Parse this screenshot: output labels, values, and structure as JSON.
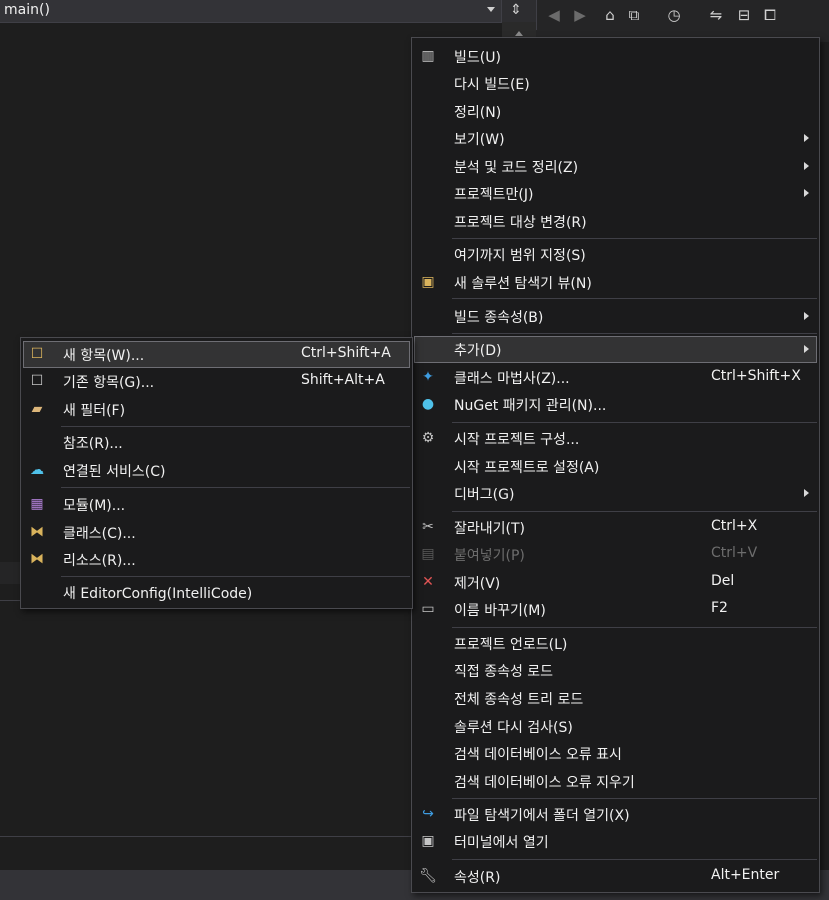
{
  "editor": {
    "function_dropdown": "main()"
  },
  "context_menu": {
    "items": [
      {
        "label": "빌드(U)",
        "icon": "build-icon"
      },
      {
        "label": "다시 빌드(E)"
      },
      {
        "label": "정리(N)"
      },
      {
        "label": "보기(W)",
        "submenu": true
      },
      {
        "label": "분석 및 코드 정리(Z)",
        "submenu": true
      },
      {
        "label": "프로젝트만(J)",
        "submenu": true
      },
      {
        "label": "프로젝트 대상 변경(R)"
      },
      {
        "label": "여기까지 범위 지정(S)"
      },
      {
        "label": "새 솔루션 탐색기 뷰(N)",
        "icon": "new-view-icon"
      },
      {
        "label": "빌드 종속성(B)",
        "submenu": true
      },
      {
        "label": "추가(D)",
        "submenu": true,
        "selected": true
      },
      {
        "label": "클래스 마법사(Z)...",
        "shortcut": "Ctrl+Shift+X",
        "icon": "class-wizard-icon"
      },
      {
        "label": "NuGet 패키지 관리(N)...",
        "icon": "nuget-icon"
      },
      {
        "label": "시작 프로젝트 구성...",
        "icon": "gear-icon"
      },
      {
        "label": "시작 프로젝트로 설정(A)"
      },
      {
        "label": "디버그(G)",
        "submenu": true
      },
      {
        "label": "잘라내기(T)",
        "shortcut": "Ctrl+X",
        "icon": "scissors-icon"
      },
      {
        "label": "붙여넣기(P)",
        "shortcut": "Ctrl+V",
        "icon": "paste-icon",
        "disabled": true
      },
      {
        "label": "제거(V)",
        "shortcut": "Del",
        "icon": "remove-icon"
      },
      {
        "label": "이름 바꾸기(M)",
        "shortcut": "F2",
        "icon": "rename-icon"
      },
      {
        "label": "프로젝트 언로드(L)"
      },
      {
        "label": "직접 종속성 로드"
      },
      {
        "label": "전체 종속성 트리 로드"
      },
      {
        "label": "솔루션 다시 검사(S)"
      },
      {
        "label": "검색 데이터베이스 오류 표시"
      },
      {
        "label": "검색 데이터베이스 오류 지우기"
      },
      {
        "label": "파일 탐색기에서 폴더 열기(X)",
        "icon": "open-folder-icon"
      },
      {
        "label": "터미널에서 열기",
        "icon": "terminal-icon"
      },
      {
        "label": "속성(R)",
        "shortcut": "Alt+Enter",
        "icon": "wrench-icon"
      }
    ]
  },
  "add_submenu": {
    "items": [
      {
        "label": "새 항목(W)...",
        "shortcut": "Ctrl+Shift+A",
        "icon": "new-item-icon",
        "selected": true
      },
      {
        "label": "기존 항목(G)...",
        "shortcut": "Shift+Alt+A",
        "icon": "existing-item-icon"
      },
      {
        "label": "새 필터(F)",
        "icon": "new-filter-icon"
      },
      {
        "label": "참조(R)..."
      },
      {
        "label": "연결된 서비스(C)",
        "icon": "connected-service-icon"
      },
      {
        "label": "모듈(M)...",
        "icon": "module-icon"
      },
      {
        "label": "클래스(C)...",
        "icon": "class-icon"
      },
      {
        "label": "리소스(R)...",
        "icon": "resource-icon"
      },
      {
        "label": "새 EditorConfig(IntelliCode)"
      }
    ]
  }
}
